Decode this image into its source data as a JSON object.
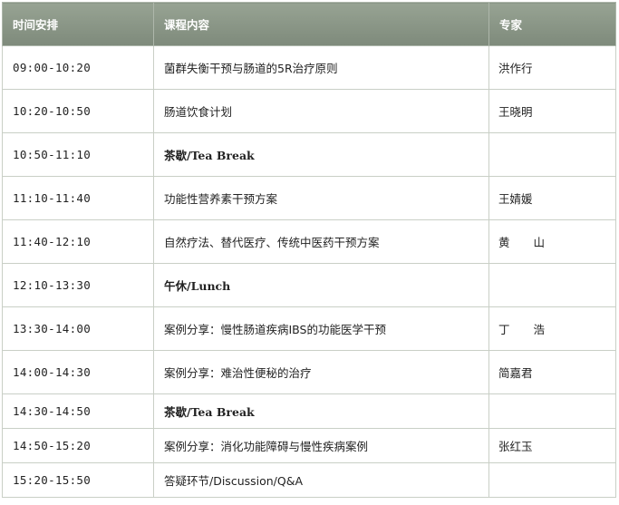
{
  "header": {
    "time": "时间安排",
    "course": "课程内容",
    "expert": "专家"
  },
  "rows": [
    {
      "time": "09:00-10:20",
      "course": "菌群失衡干预与肠道的5R治疗原则",
      "expert": "洪作行",
      "break": false,
      "height": 48
    },
    {
      "time": "10:20-10:50",
      "course": "肠道饮食计划",
      "expert": "王晓明",
      "break": false,
      "height": 48
    },
    {
      "time": "10:50-11:10",
      "course": "茶歇/Tea Break",
      "expert": "",
      "break": true,
      "height": 48
    },
    {
      "time": "11:10-11:40",
      "course": "功能性营养素干预方案",
      "expert": "王婧媛",
      "break": false,
      "height": 48
    },
    {
      "time": "11:40-12:10",
      "course": "自然疗法、替代医疗、传统中医药干预方案",
      "expert": "黄 山",
      "break": false,
      "height": 48
    },
    {
      "time": "12:10-13:30",
      "course": "午休/Lunch",
      "expert": "",
      "break": true,
      "height": 48
    },
    {
      "time": "13:30-14:00",
      "course": "案例分享：慢性肠道疾病IBS的功能医学干预",
      "expert": "丁 浩",
      "break": false,
      "height": 48
    },
    {
      "time": "14:00-14:30",
      "course": "案例分享：难治性便秘的治疗",
      "expert": "简嘉君",
      "break": false,
      "height": 48
    },
    {
      "time": "14:30-14:50",
      "course": "茶歇/Tea Break",
      "expert": "",
      "break": true,
      "height": 38
    },
    {
      "time": "14:50-15:20",
      "course": "案例分享：消化功能障碍与慢性疾病案例",
      "expert": "张红玉",
      "break": false,
      "height": 38
    },
    {
      "time": "15:20-15:50",
      "course": "答疑环节/Discussion/Q&A",
      "expert": "",
      "break": false,
      "height": 38
    }
  ]
}
